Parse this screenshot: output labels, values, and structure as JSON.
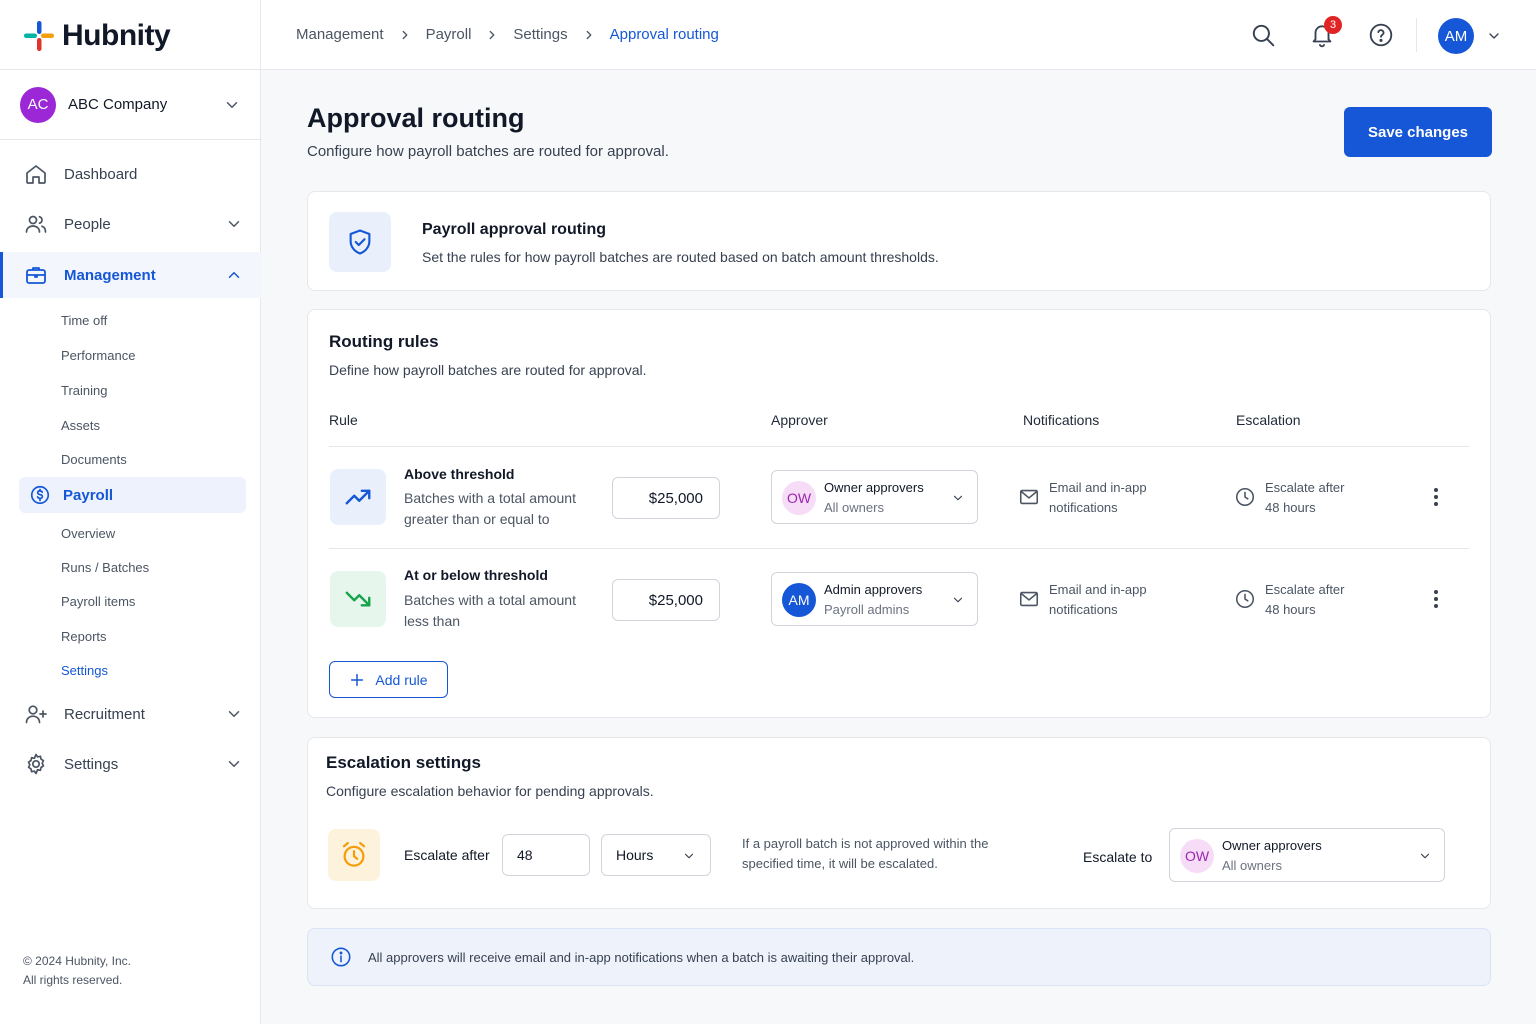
{
  "brand": {
    "name": "Hubnity",
    "color": "#1557d6"
  },
  "company": {
    "initials": "AC",
    "name": "ABC Company"
  },
  "nav": {
    "dashboard": "Dashboard",
    "people": "People",
    "management": "Management",
    "management_sub": [
      "Time off",
      "Performance",
      "Training",
      "Assets",
      "Documents"
    ],
    "payroll": "Payroll",
    "payroll_sub": [
      "Overview",
      "Runs / Batches",
      "Payroll items",
      "Reports",
      "Settings"
    ],
    "recruitment": "Recruitment",
    "settings": "Settings"
  },
  "footer": {
    "line1": "© 2024 Hubnity, Inc.",
    "line2": "All rights reserved."
  },
  "breadcrumb": [
    "Management",
    "Payroll",
    "Settings",
    "Approval routing"
  ],
  "topbar": {
    "notification_count": "3",
    "user_initials": "AM"
  },
  "page": {
    "title": "Approval routing",
    "subtitle": "Configure how payroll batches are routed for approval.",
    "save_label": "Save changes"
  },
  "info_card": {
    "title": "Payroll approval routing",
    "description": "Set the rules for how payroll batches are routed based on batch amount thresholds."
  },
  "routing": {
    "title": "Routing rules",
    "subtitle": "Define how payroll batches are routed for approval.",
    "columns": [
      "Rule",
      "Approver",
      "Notifications",
      "Escalation"
    ],
    "rules": [
      {
        "title": "Above threshold",
        "desc": "Batches with a total amount greater than or equal to",
        "amount": "$25,000",
        "approver_initials": "OW",
        "approver_name": "Owner approvers",
        "approver_group": "All owners",
        "notif_1": "Email and in-app",
        "notif_2": "notifications",
        "esc_1": "Escalate after",
        "esc_2": "48 hours"
      },
      {
        "title": "At or below threshold",
        "desc": "Batches with a total amount less than",
        "amount": "$25,000",
        "approver_initials": "AM",
        "approver_name": "Admin approvers",
        "approver_group": "Payroll admins",
        "notif_1": "Email and in-app",
        "notif_2": "notifications",
        "esc_1": "Escalate after",
        "esc_2": "48 hours"
      }
    ],
    "add_label": "Add rule"
  },
  "escalation": {
    "title": "Escalation settings",
    "subtitle": "Configure escalation behavior for pending approvals.",
    "after_label": "Escalate after",
    "after_value": "48",
    "unit": "Hours",
    "help_1": "If a payroll batch is not approved within the",
    "help_2": "specified time, it will be escalated.",
    "to_label": "Escalate to",
    "to_initials": "OW",
    "to_name": "Owner approvers",
    "to_group": "All owners"
  },
  "banner": "All approvers will receive email and in-app notifications when a batch is awaiting their approval."
}
